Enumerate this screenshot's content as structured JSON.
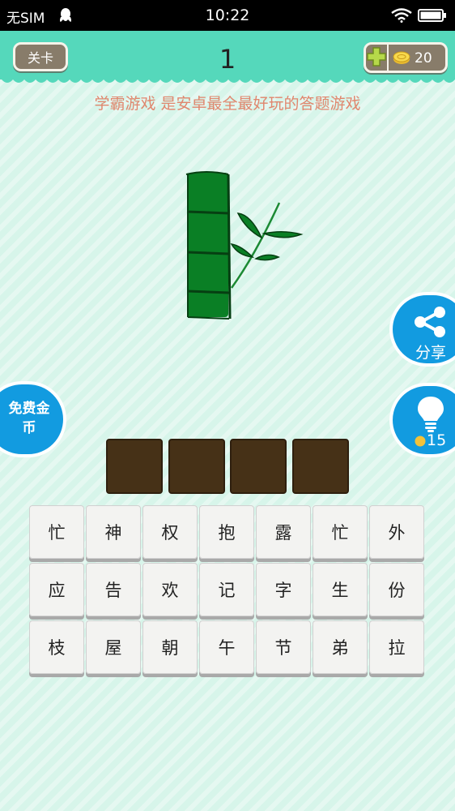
{
  "status_bar": {
    "carrier": "无SIM",
    "time": "10:22"
  },
  "header": {
    "level_button_label": "关卡",
    "level_number": "1",
    "coins": "20"
  },
  "slogan": "学霸游戏 是安卓最全最好玩的答题游戏",
  "side_buttons": {
    "share_label": "分享",
    "hint_cost": "15",
    "free_coins_label": "免费金币"
  },
  "answer_slots": [
    "",
    "",
    "",
    ""
  ],
  "keyboard": [
    [
      "忙",
      "神",
      "权",
      "抱",
      "露",
      "忙",
      "外"
    ],
    [
      "应",
      "告",
      "欢",
      "记",
      "字",
      "生",
      "份"
    ],
    [
      "枝",
      "屋",
      "朝",
      "午",
      "节",
      "弟",
      "拉"
    ]
  ],
  "colors": {
    "header": "#55d8bb",
    "background": "#d7f5ea",
    "side_button": "#129be0",
    "answer_slot": "#463117",
    "slogan": "#e0866d",
    "bamboo": "#0a7f25"
  },
  "icons": [
    "qq-icon",
    "wifi-icon",
    "battery-icon",
    "add-coin-icon",
    "coin-icon",
    "share-icon",
    "bulb-icon"
  ]
}
